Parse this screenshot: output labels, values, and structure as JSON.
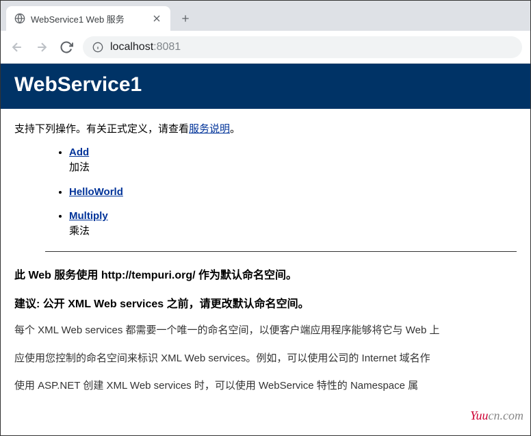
{
  "browser": {
    "tab_title": "WebService1 Web 服务",
    "url_host": "localhost",
    "url_port": ":8081"
  },
  "page": {
    "title": "WebService1",
    "intro_prefix": "支持下列操作。有关正式定义，请查看",
    "intro_link": "服务说明",
    "intro_suffix": "。",
    "operations": [
      {
        "name": "Add",
        "desc": "加法"
      },
      {
        "name": "HelloWorld",
        "desc": ""
      },
      {
        "name": "Multiply",
        "desc": "乘法"
      }
    ],
    "ns_notice": "此 Web 服务使用 http://tempuri.org/ 作为默认命名空间。",
    "ns_suggest": "建议: 公开 XML Web services 之前，请更改默认命名空间。",
    "ns_para1": "每个 XML Web services 都需要一个唯一的命名空间，以便客户端应用程序能够将它与 Web 上",
    "ns_para2": "应使用您控制的命名空间来标识 XML Web services。例如，可以使用公司的 Internet 域名作",
    "ns_para3": "使用 ASP.NET 创建 XML Web services 时，可以使用 WebService 特性的 Namespace 属"
  },
  "watermark": {
    "red": "Yuu",
    "gray": "cn.com"
  }
}
